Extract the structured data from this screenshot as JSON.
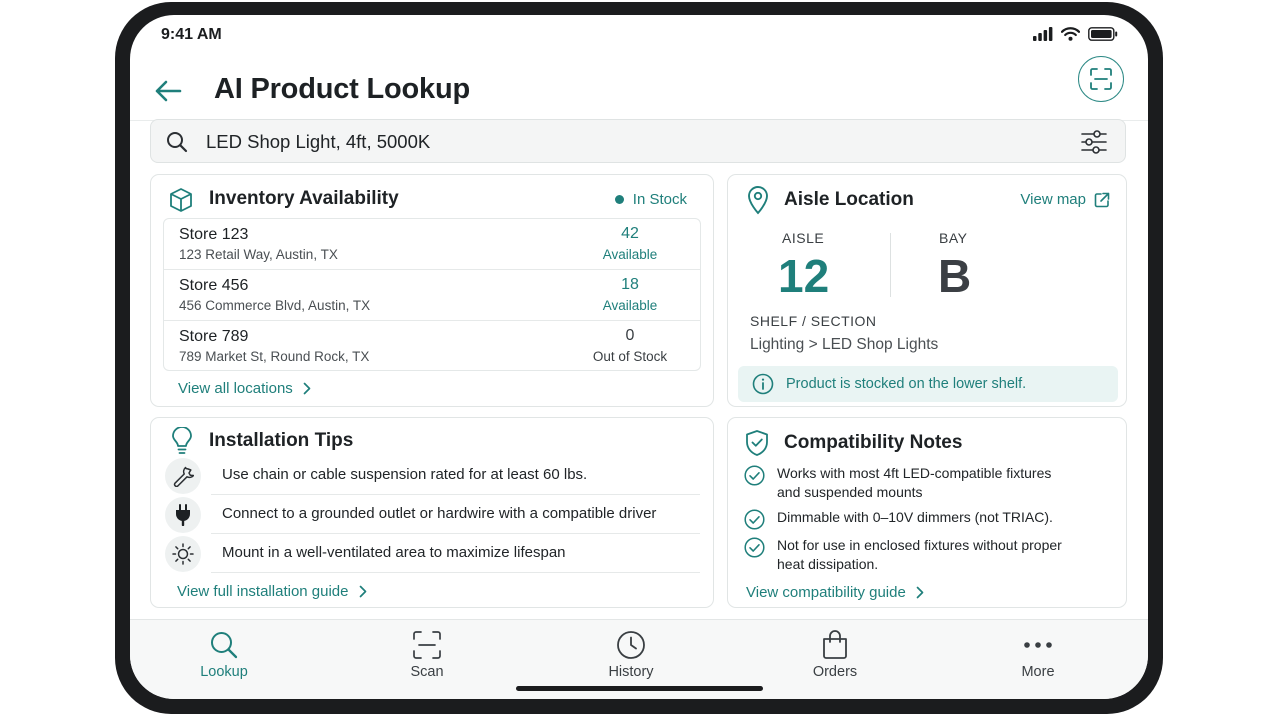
{
  "status_bar": {
    "time": "9:41 AM"
  },
  "header": {
    "title": "AI Product Lookup"
  },
  "search": {
    "value": "LED Shop Light, 4ft, 5000K",
    "placeholder": ""
  },
  "inventory": {
    "title": "Inventory Availability",
    "status": "In Stock",
    "stores": [
      {
        "name": "Store 123",
        "address": "123 Retail Way, Austin, TX",
        "count": "42",
        "status": "Available"
      },
      {
        "name": "Store 456",
        "address": "456 Commerce Blvd, Austin, TX",
        "count": "18",
        "status": "Available"
      },
      {
        "name": "Store 789",
        "address": "789 Market St, Round Rock, TX",
        "count": "0",
        "status": "Out of Stock"
      }
    ],
    "link": "View all locations"
  },
  "aisle": {
    "title": "Aisle Location",
    "view_map": "View map",
    "aisle_label": "AISLE",
    "aisle_value": "12",
    "bay_label": "BAY",
    "bay_value": "B",
    "shelf_label": "SHELF / SECTION",
    "shelf_value": "Lighting > LED Shop Lights",
    "note": "Product is stocked on the lower shelf."
  },
  "installation": {
    "title": "Installation Tips",
    "tips": [
      {
        "icon": "wrench-icon",
        "text": "Use chain or cable suspension rated for at least 60 lbs."
      },
      {
        "icon": "plug-icon",
        "text": "Connect to a grounded outlet or hardwire with a compatible driver"
      },
      {
        "icon": "sun-icon",
        "text": "Mount in a well-ventilated area to maximize lifespan"
      }
    ],
    "link": "View full installation guide"
  },
  "compatibility": {
    "title": "Compatibility Notes",
    "notes": [
      {
        "line1": "Works with most 4ft LED-compatible fixtures",
        "line2": "and suspended mounts"
      },
      {
        "line1": "Dimmable with 0–10V dimmers (not TRIAC).",
        "line2": ""
      },
      {
        "line1": "Not for use in enclosed fixtures without proper",
        "line2": "heat dissipation."
      }
    ],
    "link": "View compatibility guide"
  },
  "tabs": [
    {
      "label": "Lookup",
      "icon": "search-icon",
      "active": true
    },
    {
      "label": "Scan",
      "icon": "scan-icon",
      "active": false
    },
    {
      "label": "History",
      "icon": "clock-icon",
      "active": false
    },
    {
      "label": "Orders",
      "icon": "bag-icon",
      "active": false
    },
    {
      "label": "More",
      "icon": "more-icon",
      "active": false
    }
  ],
  "colors": {
    "accent": "#1f7f7b",
    "text": "#1f2326",
    "note_bg": "#e9f4f3",
    "device_frame": "#1b1c1e"
  }
}
